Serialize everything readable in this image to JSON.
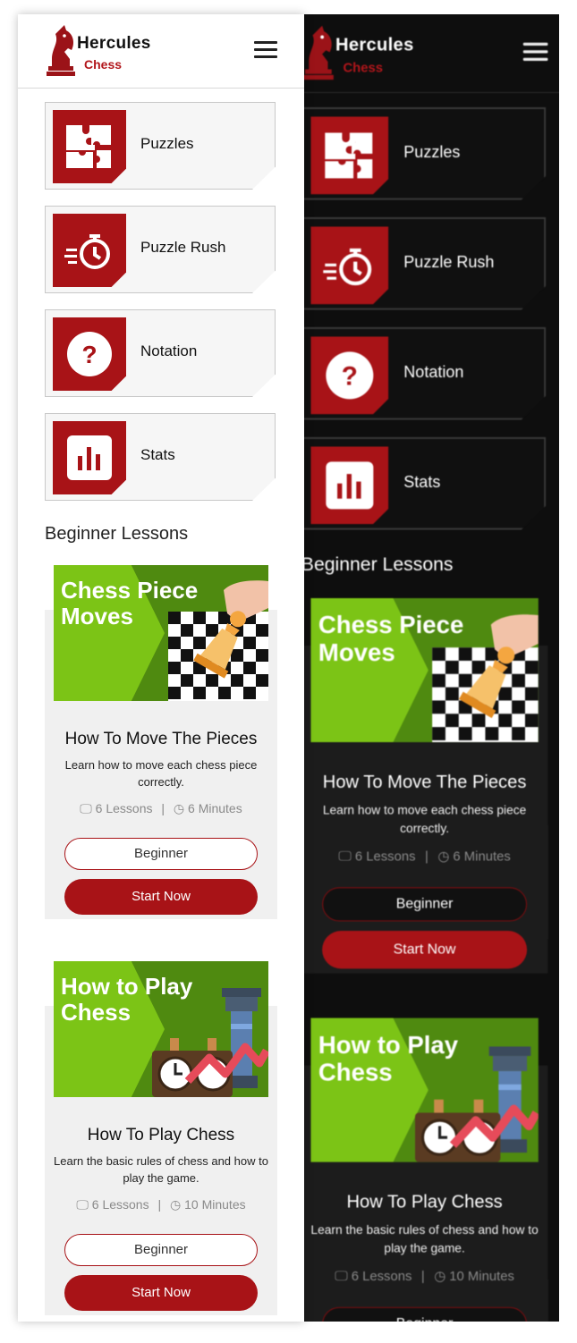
{
  "brand": {
    "name": "Hercules",
    "sub": "Chess"
  },
  "menu": {
    "icon": "hamburger-menu-icon"
  },
  "tiles": [
    {
      "label": "Puzzles",
      "icon": "puzzle-pieces-icon"
    },
    {
      "label": "Puzzle Rush",
      "icon": "timer-rush-icon"
    },
    {
      "label": "Notation",
      "icon": "question-mark-icon"
    },
    {
      "label": "Stats",
      "icon": "bar-chart-icon"
    }
  ],
  "lessons_heading": "Beginner Lessons",
  "lessons": [
    {
      "thumb_title_line1": "Chess Piece",
      "thumb_title_line2": "Moves",
      "title": "How To Move The Pieces",
      "description": "Learn how to move each chess piece correctly.",
      "lessons": "6 Lessons",
      "duration": "6 Minutes",
      "level": "Beginner",
      "cta": "Start Now"
    },
    {
      "thumb_title_line1": "How to Play",
      "thumb_title_line2": "Chess",
      "title": "How To Play Chess",
      "description": "Learn the basic rules of chess and how to play the game.",
      "lessons": "6 Lessons",
      "duration": "10 Minutes",
      "level": "Beginner",
      "cta": "Start Now"
    }
  ],
  "colors": {
    "accent": "#a81317",
    "green": "#7cc416",
    "dark_bg": "#0e0e0e"
  }
}
